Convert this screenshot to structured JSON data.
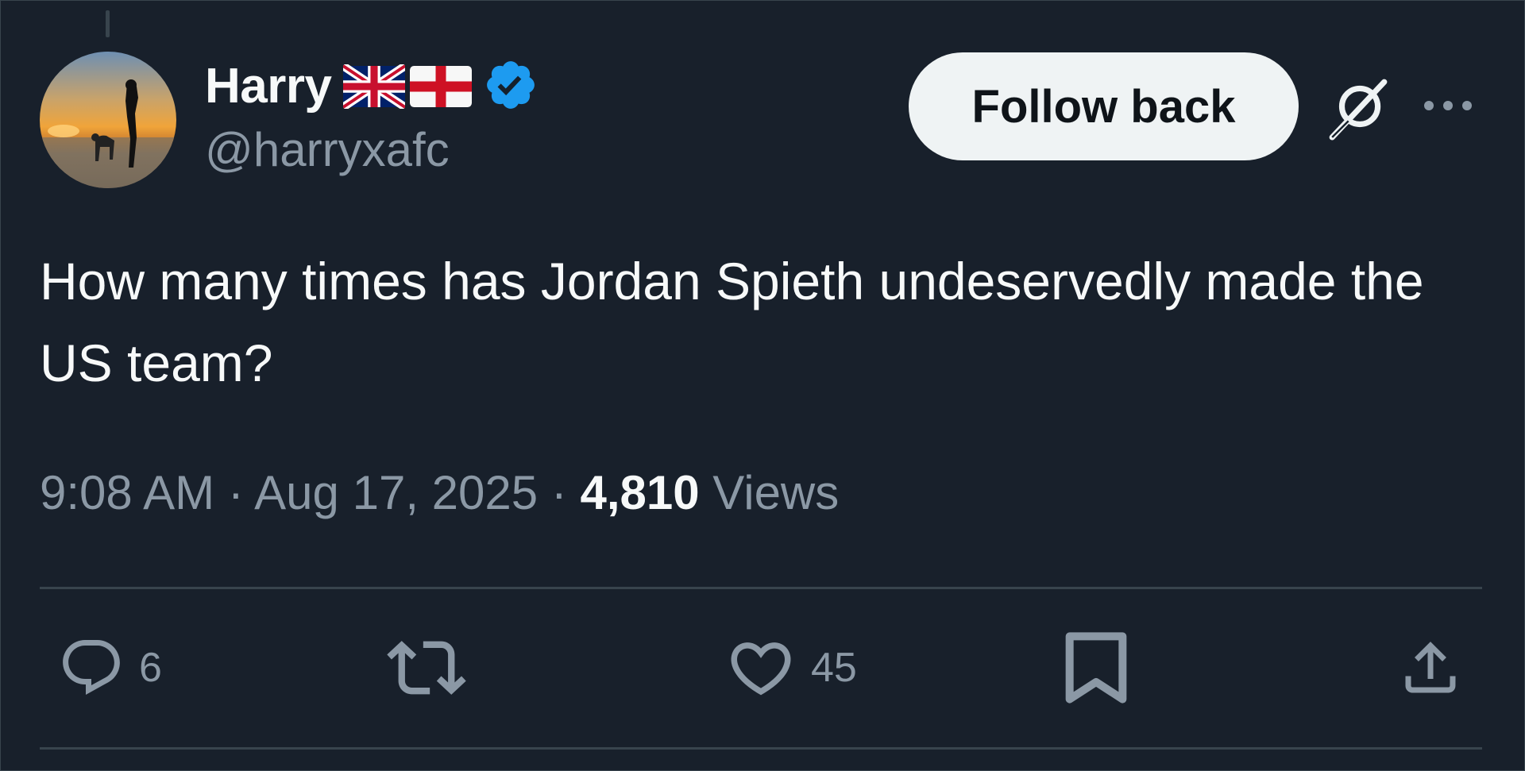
{
  "author": {
    "display_name": "Harry",
    "handle": "@harryxafc",
    "flags": [
      "uk-flag-icon",
      "england-flag-icon"
    ],
    "verified": true,
    "verified_color": "#1d9bf0"
  },
  "header_actions": {
    "follow_label": "Follow back",
    "grok_icon": "grok-icon",
    "more_icon": "more-dots-icon"
  },
  "tweet": {
    "text": "How many times has Jordan Spieth undeservedly made the US team?",
    "time": "9:08 AM",
    "date": "Aug 17, 2025",
    "views_count": "4,810",
    "views_label": "Views"
  },
  "engagement": {
    "replies": "6",
    "retweets": "",
    "likes": "45"
  },
  "colors": {
    "background": "#15202b",
    "text_primary": "#f7f9f9",
    "text_secondary": "#8b98a5",
    "border": "#38444d",
    "button_bg": "#eff3f4"
  }
}
